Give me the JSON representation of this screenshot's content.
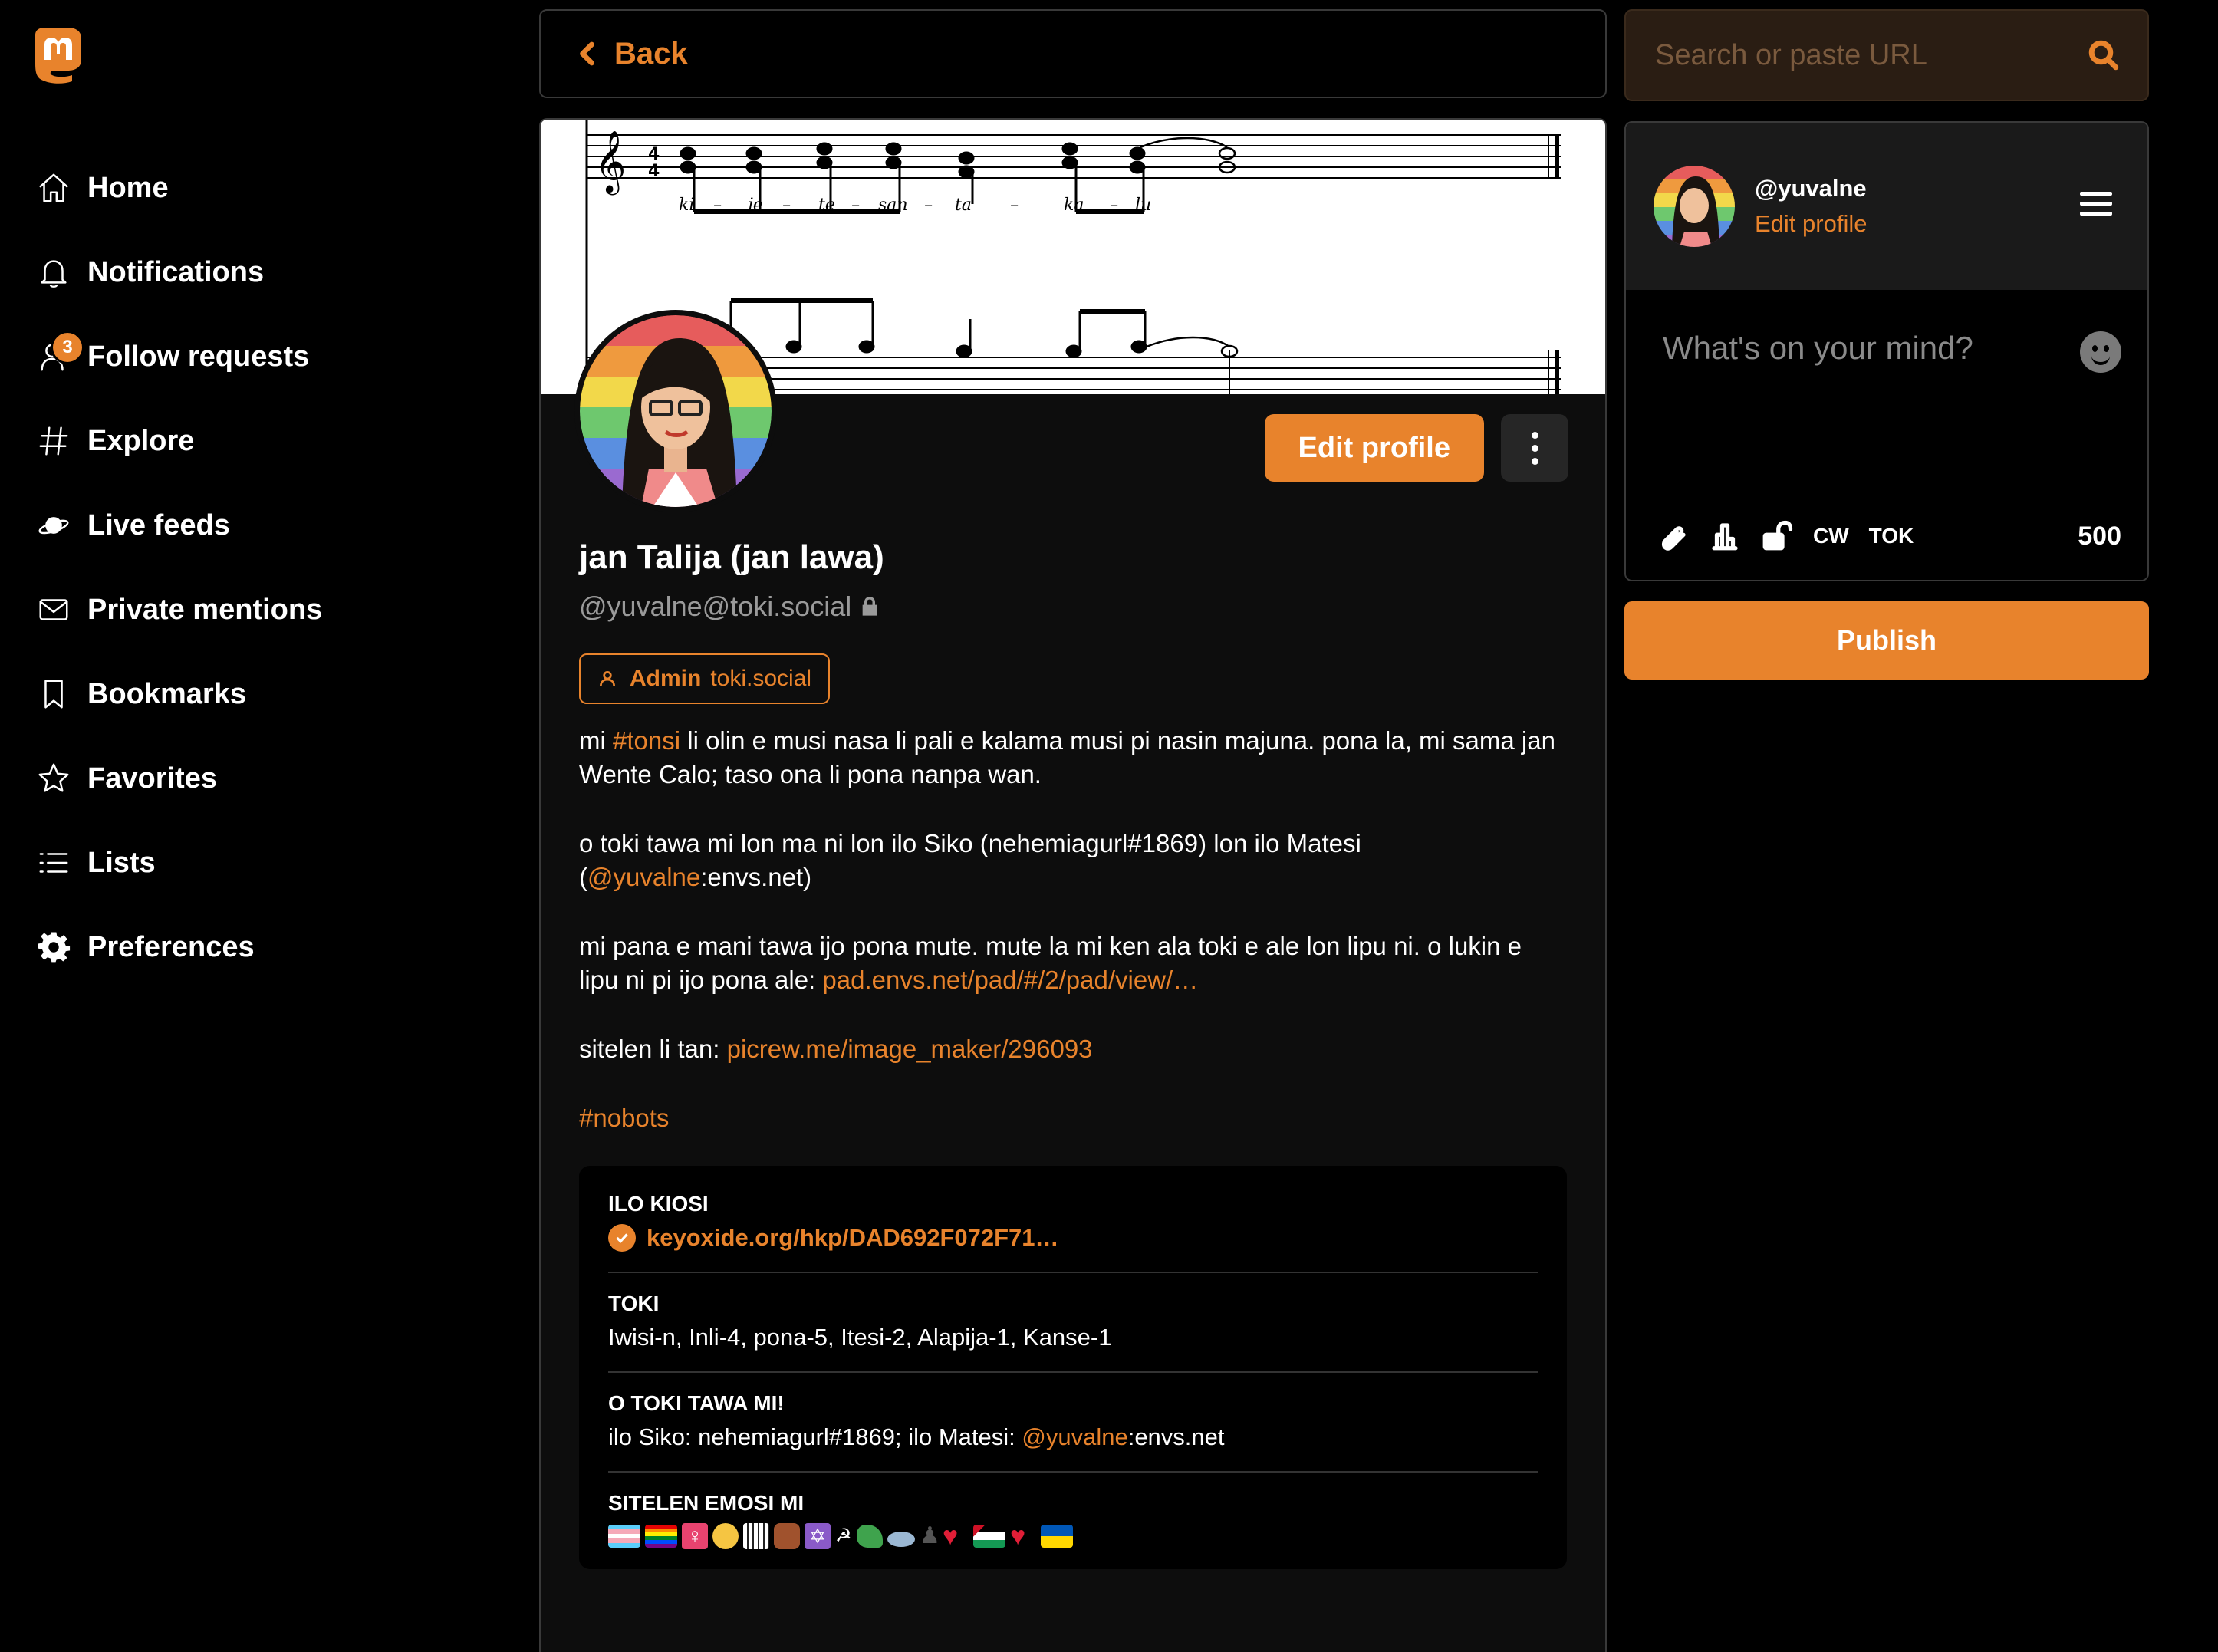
{
  "nav": {
    "items": [
      {
        "label": "Home",
        "icon": "home-icon"
      },
      {
        "label": "Notifications",
        "icon": "bell-icon"
      },
      {
        "label": "Follow requests",
        "icon": "person-icon",
        "badge": "3"
      },
      {
        "label": "Explore",
        "icon": "hashtag-icon"
      },
      {
        "label": "Live feeds",
        "icon": "planet-icon"
      },
      {
        "label": "Private mentions",
        "icon": "envelope-icon"
      },
      {
        "label": "Bookmarks",
        "icon": "bookmark-icon"
      },
      {
        "label": "Favorites",
        "icon": "star-icon"
      },
      {
        "label": "Lists",
        "icon": "list-icon"
      },
      {
        "label": "Preferences",
        "icon": "gear-icon"
      }
    ]
  },
  "header": {
    "back_label": "Back"
  },
  "header_image": {
    "lyrics": [
      "ki",
      "je",
      "te",
      "san",
      "ta",
      "ka",
      "lu"
    ]
  },
  "profile": {
    "display_name": "jan Talija (jan lawa)",
    "acct": "@yuvalne@toki.social",
    "edit_label": "Edit profile",
    "role": {
      "label": "Admin",
      "domain": "toki.social"
    },
    "bio": {
      "p1_a": "mi ",
      "p1_tag": "#tonsi",
      "p1_b": " li olin e musi nasa li pali e kalama musi pi nasin majuna. pona la, mi sama jan Wente Calo; taso ona li pona nanpa wan.",
      "p2_a": "o toki tawa mi lon ma ni lon ilo Siko (nehemiagurl#1869) lon ilo Matesi (",
      "p2_mention": "@yuvalne",
      "p2_b": ":envs.net)",
      "p3_a": "mi pana e mani tawa ijo pona mute. mute la mi ken ala toki e ale lon lipu ni. o lukin e lipu ni pi ijo pona ale: ",
      "p3_link": "pad.envs.net/pad/#/2/pad/view/…",
      "p4_a": "sitelen li tan: ",
      "p4_link": "picrew.me/image_maker/296093",
      "p5_tag": "#nobots"
    },
    "fields": [
      {
        "name": "ILO KIOSI",
        "value": "keyoxide.org/hkp/DAD692F072F71…",
        "verified": true
      },
      {
        "name": "TOKI",
        "value": "Iwisi-n, Inli-4, pona-5, Itesi-2, Alapija-1, Kanse-1"
      },
      {
        "name": "O TOKI TAWA MI!",
        "value_a": "ilo Siko: nehemiagurl#1869; ilo Matesi: ",
        "value_mention": "@yuvalne",
        "value_b": ":envs.net"
      },
      {
        "name": "SITELEN EMOSI MI",
        "emojis": [
          "transgender-flag",
          "rainbow-flag",
          "female-sign",
          "nerd-face",
          "piano",
          "technologist",
          "star-of-david",
          "hammer-sickle",
          "dragon",
          "ufo",
          "chess-pawn",
          "red-heart",
          "palestine-flag",
          "red-heart",
          "ukraine-flag"
        ]
      }
    ]
  },
  "search": {
    "placeholder": "Search or paste URL"
  },
  "composer": {
    "handle": "@yuvalne",
    "edit_profile": "Edit profile",
    "placeholder": "What's on your mind?",
    "cw_label": "CW",
    "lang_label": "TOK",
    "char_count": "500",
    "publish_label": "Publish"
  },
  "colors": {
    "accent": "#e8832c",
    "background": "#000000",
    "card": "#0d0d0d"
  }
}
